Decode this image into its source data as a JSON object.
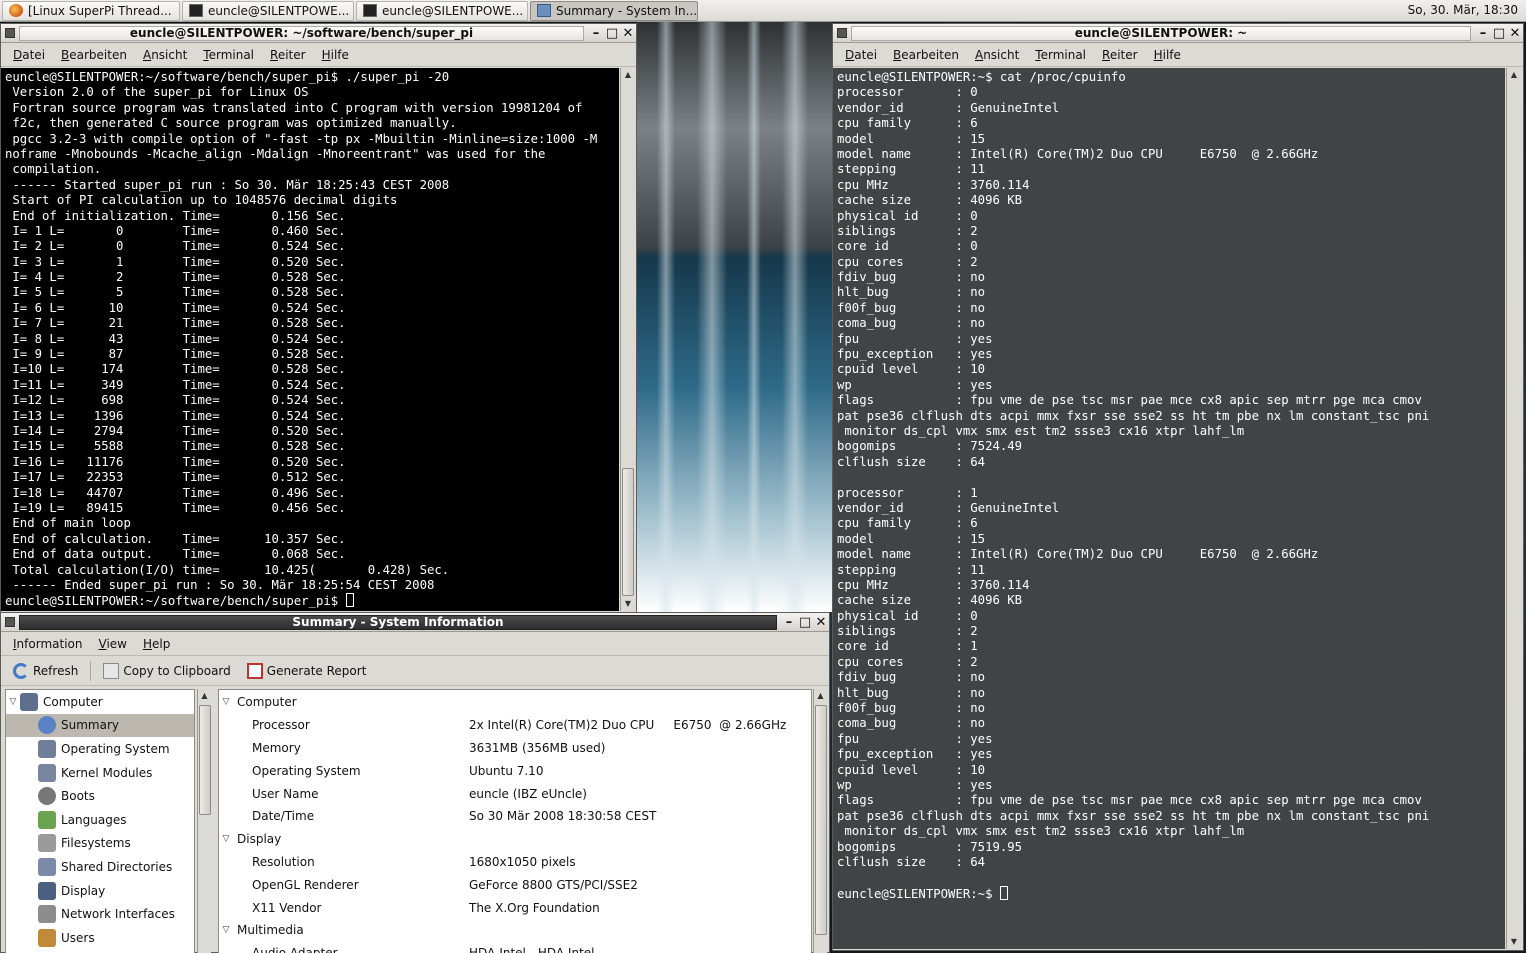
{
  "taskbar": {
    "tasks": [
      {
        "label": "[Linux SuperPi Thread...",
        "icon": "firefox-icon"
      },
      {
        "label": "euncle@SILENTPOWE...",
        "icon": "terminal-icon"
      },
      {
        "label": "euncle@SILENTPOWE...",
        "icon": "terminal-icon"
      },
      {
        "label": "Summary - System In...",
        "icon": "sysinfo-icon"
      }
    ],
    "clock": "So, 30. Mär, 18:30"
  },
  "term_menu": [
    "Datei",
    "Bearbeiten",
    "Ansicht",
    "Terminal",
    "Reiter",
    "Hilfe"
  ],
  "term1": {
    "title": "euncle@SILENTPOWER: ~/software/bench/super_pi",
    "lines": [
      "euncle@SILENTPOWER:~/software/bench/super_pi$ ./super_pi -20",
      " Version 2.0 of the super_pi for Linux OS",
      " Fortran source program was translated into C program with version 19981204 of",
      " f2c, then generated C source program was optimized manually.",
      " pgcc 3.2-3 with compile option of \"-fast -tp px -Mbuiltin -Minline=size:1000 -M",
      "noframe -Mnobounds -Mcache_align -Mdalign -Mnoreentrant\" was used for the",
      " compilation.",
      " ------ Started super_pi run : So 30. Mär 18:25:43 CEST 2008",
      " Start of PI calculation up to 1048576 decimal digits",
      " End of initialization. Time=       0.156 Sec.",
      " I= 1 L=       0        Time=       0.460 Sec.",
      " I= 2 L=       0        Time=       0.524 Sec.",
      " I= 3 L=       1        Time=       0.520 Sec.",
      " I= 4 L=       2        Time=       0.528 Sec.",
      " I= 5 L=       5        Time=       0.528 Sec.",
      " I= 6 L=      10        Time=       0.524 Sec.",
      " I= 7 L=      21        Time=       0.528 Sec.",
      " I= 8 L=      43        Time=       0.524 Sec.",
      " I= 9 L=      87        Time=       0.528 Sec.",
      " I=10 L=     174        Time=       0.528 Sec.",
      " I=11 L=     349        Time=       0.524 Sec.",
      " I=12 L=     698        Time=       0.524 Sec.",
      " I=13 L=    1396        Time=       0.524 Sec.",
      " I=14 L=    2794        Time=       0.520 Sec.",
      " I=15 L=    5588        Time=       0.528 Sec.",
      " I=16 L=   11176        Time=       0.520 Sec.",
      " I=17 L=   22353        Time=       0.512 Sec.",
      " I=18 L=   44707        Time=       0.496 Sec.",
      " I=19 L=   89415        Time=       0.456 Sec.",
      " End of main loop",
      " End of calculation.    Time=      10.357 Sec.",
      " End of data output.    Time=       0.068 Sec.",
      " Total calculation(I/O) time=      10.425(       0.428) Sec.",
      " ------ Ended super_pi run : So 30. Mär 18:25:54 CEST 2008"
    ],
    "prompt": "euncle@SILENTPOWER:~/software/bench/super_pi$ "
  },
  "term2": {
    "title": "euncle@SILENTPOWER: ~",
    "lines": [
      "euncle@SILENTPOWER:~$ cat /proc/cpuinfo",
      "processor       : 0",
      "vendor_id       : GenuineIntel",
      "cpu family      : 6",
      "model           : 15",
      "model name      : Intel(R) Core(TM)2 Duo CPU     E6750  @ 2.66GHz",
      "stepping        : 11",
      "cpu MHz         : 3760.114",
      "cache size      : 4096 KB",
      "physical id     : 0",
      "siblings        : 2",
      "core id         : 0",
      "cpu cores       : 2",
      "fdiv_bug        : no",
      "hlt_bug         : no",
      "f00f_bug        : no",
      "coma_bug        : no",
      "fpu             : yes",
      "fpu_exception   : yes",
      "cpuid level     : 10",
      "wp              : yes",
      "flags           : fpu vme de pse tsc msr pae mce cx8 apic sep mtrr pge mca cmov",
      "pat pse36 clflush dts acpi mmx fxsr sse sse2 ss ht tm pbe nx lm constant_tsc pni",
      " monitor ds_cpl vmx smx est tm2 ssse3 cx16 xtpr lahf_lm",
      "bogomips        : 7524.49",
      "clflush size    : 64",
      "",
      "processor       : 1",
      "vendor_id       : GenuineIntel",
      "cpu family      : 6",
      "model           : 15",
      "model name      : Intel(R) Core(TM)2 Duo CPU     E6750  @ 2.66GHz",
      "stepping        : 11",
      "cpu MHz         : 3760.114",
      "cache size      : 4096 KB",
      "physical id     : 0",
      "siblings        : 2",
      "core id         : 1",
      "cpu cores       : 2",
      "fdiv_bug        : no",
      "hlt_bug         : no",
      "f00f_bug        : no",
      "coma_bug        : no",
      "fpu             : yes",
      "fpu_exception   : yes",
      "cpuid level     : 10",
      "wp              : yes",
      "flags           : fpu vme de pse tsc msr pae mce cx8 apic sep mtrr pge mca cmov",
      "pat pse36 clflush dts acpi mmx fxsr sse sse2 ss ht tm pbe nx lm constant_tsc pni",
      " monitor ds_cpl vmx smx est tm2 ssse3 cx16 xtpr lahf_lm",
      "bogomips        : 7519.95",
      "clflush size    : 64",
      ""
    ],
    "prompt": "euncle@SILENTPOWER:~$ "
  },
  "sysinfo": {
    "title": "Summary - System Information",
    "menu": [
      "Information",
      "View",
      "Help"
    ],
    "toolbar": {
      "refresh": "Refresh",
      "copy": "Copy to Clipboard",
      "report": "Generate Report"
    },
    "tree_root": "Computer",
    "tree": [
      {
        "label": "Summary",
        "icon": "info-icon",
        "color": "#5b82c4",
        "selected": true
      },
      {
        "label": "Operating System",
        "icon": "gear-icon",
        "color": "#6f7f99"
      },
      {
        "label": "Kernel Modules",
        "icon": "module-icon",
        "color": "#7a86a0"
      },
      {
        "label": "Boots",
        "icon": "power-icon",
        "color": "#777777"
      },
      {
        "label": "Languages",
        "icon": "books-icon",
        "color": "#6ba34f"
      },
      {
        "label": "Filesystems",
        "icon": "disk-icon",
        "color": "#9a9a9a"
      },
      {
        "label": "Shared Directories",
        "icon": "folder-icon",
        "color": "#7b8aa6"
      },
      {
        "label": "Display",
        "icon": "monitor-icon",
        "color": "#4b5f80"
      },
      {
        "label": "Network Interfaces",
        "icon": "network-icon",
        "color": "#8d8d8d"
      },
      {
        "label": "Users",
        "icon": "users-icon",
        "color": "#c08a3a"
      }
    ],
    "details": [
      {
        "group": "Computer",
        "rows": [
          [
            "Processor",
            "2x Intel(R) Core(TM)2 Duo CPU     E6750  @ 2.66GHz"
          ],
          [
            "Memory",
            "3631MB (356MB used)"
          ],
          [
            "Operating System",
            "Ubuntu 7.10"
          ],
          [
            "User Name",
            "euncle (IBZ eUncle)"
          ],
          [
            "Date/Time",
            "So 30 Mär 2008 18:30:58 CEST"
          ]
        ]
      },
      {
        "group": "Display",
        "rows": [
          [
            "Resolution",
            "1680x1050 pixels"
          ],
          [
            "OpenGL Renderer",
            "GeForce 8800 GTS/PCI/SSE2"
          ],
          [
            "X11 Vendor",
            "The X.Org Foundation"
          ]
        ]
      },
      {
        "group": "Multimedia",
        "rows": [
          [
            "Audio Adapter",
            "HDA-Intel - HDA Intel"
          ]
        ]
      }
    ]
  }
}
